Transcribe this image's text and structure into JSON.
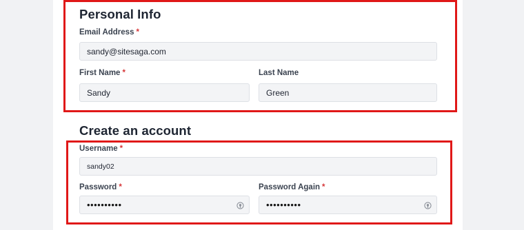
{
  "personal": {
    "title": "Personal Info",
    "email_label": "Email Address",
    "email_value": "sandy@sitesaga.com",
    "first_label": "First Name",
    "first_value": "Sandy",
    "last_label": "Last Name",
    "last_value": "Green"
  },
  "account": {
    "title": "Create an account",
    "username_label": "Username",
    "username_value": "sandy02",
    "password_label": "Password",
    "password_value": "••••••••••",
    "password_again_label": "Password Again",
    "password_again_value": "••••••••••"
  },
  "required_marker": "*",
  "colors": {
    "highlight": "#e01818",
    "required": "#d63638",
    "field_bg": "#f3f4f6"
  },
  "icons": {
    "password_toggle": "eye-icon"
  }
}
